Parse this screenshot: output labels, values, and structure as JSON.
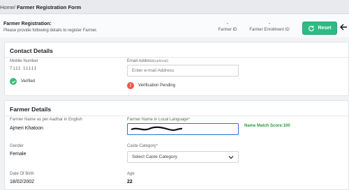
{
  "breadcrumb": {
    "home": "Home/",
    "current": "Farmer Registration Form"
  },
  "header": {
    "title": "Farmer Registration:",
    "subtitle": "Please provide following details to register Farmer.",
    "farmer_id_label": "Farmer ID",
    "farmer_id_value": "-",
    "enrollment_id_label": "Farmer Enrollment ID",
    "enrollment_id_value": "-",
    "reset_label": "Reset"
  },
  "contact": {
    "heading": "Contact Details",
    "mobile_label": "Mobile Number",
    "mobile_value": "7111 11111",
    "verified_text": "Verified",
    "email_label": "Email Address",
    "email_optional": "(optional)",
    "email_placeholder": "Enter e-mail Address",
    "pending_text": "Verification Pending"
  },
  "farmer": {
    "heading": "Farmer Details",
    "aadhar_name_label": "Farmer Name as per Aadhar in English",
    "aadhar_name_value": "Ajmeri Khatoon",
    "local_name_label": "Farmer Name in Local Language",
    "required_mark": "*",
    "match_score": "Name Match Score:100",
    "gender_label": "Gender",
    "gender_value": "Female",
    "caste_label": "Caste Category",
    "caste_placeholder": "Select Caste Category",
    "dob_label": "Date Of Birth",
    "dob_value": "18/02/2002",
    "age_label": "Age",
    "age_value": "22"
  },
  "colors": {
    "accent": "#2fb985",
    "focus": "#2b6fd6",
    "success": "#3dbb7a",
    "warning": "#e8584b",
    "score": "#2c9b3d"
  },
  "icons": {
    "reset": "refresh-icon",
    "back": "arrow-left-icon",
    "verified": "check-circle-icon",
    "pending": "alert-circle-icon",
    "dropdown": "chevron-down-icon"
  }
}
